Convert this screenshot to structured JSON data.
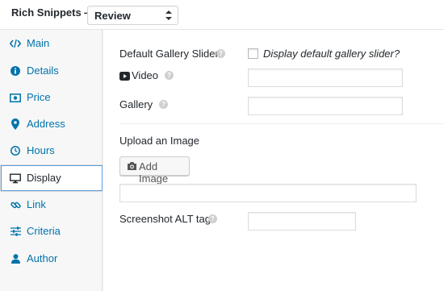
{
  "header": {
    "title": "Rich Snippets —",
    "select_value": "Review"
  },
  "sidebar": {
    "items": [
      {
        "label": "Main",
        "icon": "code-icon",
        "active": false
      },
      {
        "label": "Details",
        "icon": "info-icon",
        "active": false
      },
      {
        "label": "Price",
        "icon": "money-icon",
        "active": false
      },
      {
        "label": "Address",
        "icon": "map-marker-icon",
        "active": false
      },
      {
        "label": "Hours",
        "icon": "clock-icon",
        "active": false
      },
      {
        "label": "Display",
        "icon": "desktop-icon",
        "active": true
      },
      {
        "label": "Link",
        "icon": "link-icon",
        "active": false
      },
      {
        "label": "Criteria",
        "icon": "sliders-icon",
        "active": false
      },
      {
        "label": "Author",
        "icon": "user-icon",
        "active": false
      }
    ]
  },
  "form": {
    "default_gallery_slider_label": "Default Gallery Slider",
    "display_default_gallery_slider": "Display default gallery slider?",
    "display_default_gallery_slider_checked": false,
    "video_label": "Video",
    "video_value": "",
    "gallery_label": "Gallery",
    "gallery_value": "",
    "upload_image_label": "Upload an Image",
    "add_image_button": "Add Image",
    "image_url_value": "",
    "screenshot_alt_label": "Screenshot ALT tag",
    "screenshot_alt_value": "",
    "help_symbol": "?"
  },
  "colors": {
    "link": "#0073aa",
    "text": "#23282d",
    "focus_border": "#5b9dd9"
  }
}
